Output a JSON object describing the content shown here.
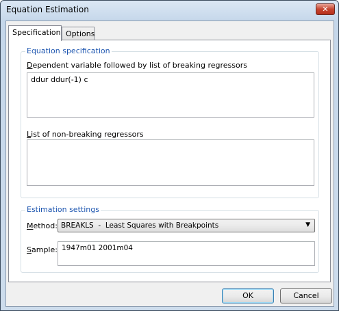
{
  "window": {
    "title": "Equation Estimation",
    "close_icon": "close-icon"
  },
  "tabs": [
    {
      "label": "Specification",
      "active": true
    },
    {
      "label": "Options",
      "active": false
    }
  ],
  "equation_spec": {
    "group_label": "Equation specification",
    "dep_label_ul": "D",
    "dep_label_rest": "ependent variable followed by list of breaking regressors",
    "dep_value": "ddur ddur(-1) c",
    "nonbreak_label_ul": "L",
    "nonbreak_label_rest": "ist of non-breaking regressors",
    "nonbreak_value": ""
  },
  "estimation": {
    "group_label": "Estimation settings",
    "method_label_ul": "M",
    "method_label_rest": "ethod:",
    "method_value": "BREAKLS  -  Least Squares with Breakpoints",
    "sample_label_ul": "S",
    "sample_label_rest": "ample:",
    "sample_value": "1947m01 2001m04"
  },
  "buttons": {
    "ok": "OK",
    "cancel": "Cancel"
  }
}
